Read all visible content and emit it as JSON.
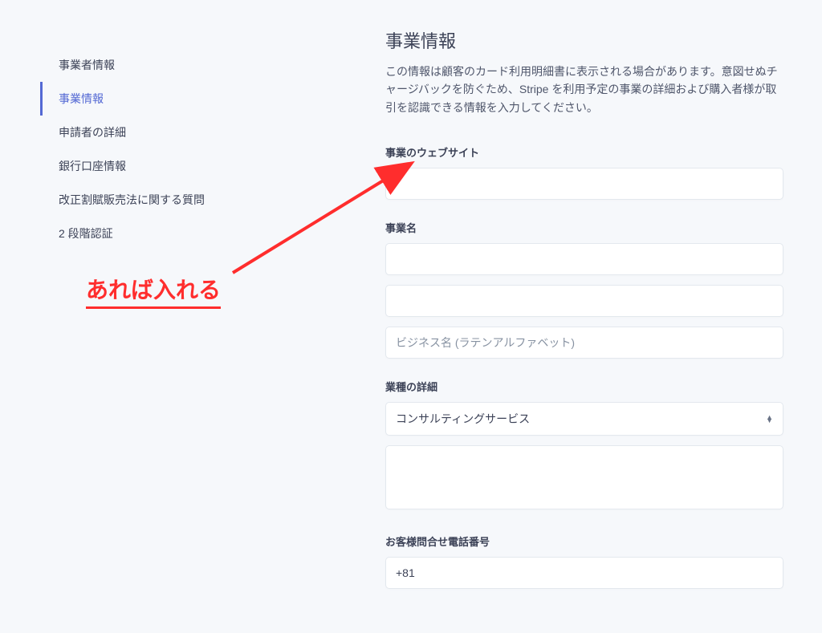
{
  "sidebar": {
    "items": [
      {
        "label": "事業者情報"
      },
      {
        "label": "事業情報"
      },
      {
        "label": "申請者の詳細"
      },
      {
        "label": "銀行口座情報"
      },
      {
        "label": "改正割賦販売法に関する質問"
      },
      {
        "label": "2 段階認証"
      }
    ]
  },
  "main": {
    "title": "事業情報",
    "description": "この情報は顧客のカード利用明細書に表示される場合があります。意図せぬチャージバックを防ぐため、Stripe を利用予定の事業の詳細および購入者様が取引を認識できる情報を入力してください。",
    "website_label": "事業のウェブサイト",
    "website_value": "",
    "business_name_label": "事業名",
    "business_name_value": "",
    "business_name_latin_value": "",
    "business_name_latin_placeholder": "ビジネス名 (ラテンアルファベット)",
    "business_category_label": "業種の詳細",
    "business_category_value": "コンサルティングサービス",
    "business_description_value": "",
    "phone_label": "お客様問合せ電話番号",
    "phone_value": "+81"
  },
  "annotation": {
    "text": "あれば入れる"
  }
}
